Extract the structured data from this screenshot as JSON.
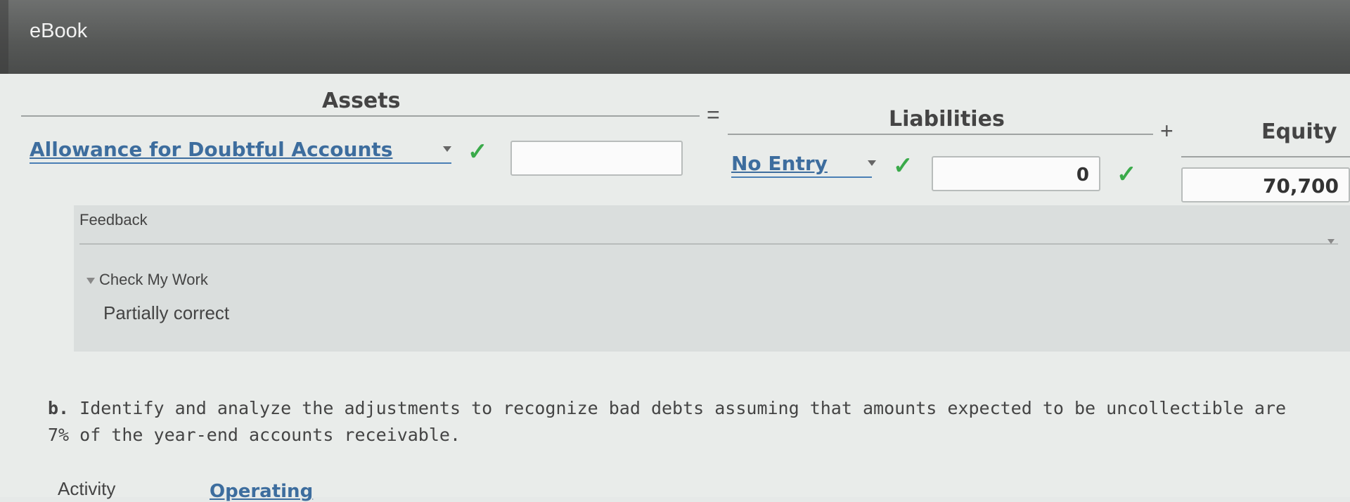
{
  "app": {
    "title": "eBook"
  },
  "equation": {
    "assets_label": "Assets",
    "equals_symbol": "=",
    "liabilities_label": "Liabilities",
    "plus_symbol": "+",
    "equity_label": "Equity"
  },
  "row": {
    "assets_account": "Allowance for Doubtful Accounts",
    "assets_amount": "",
    "liabilities_account": "No Entry",
    "liabilities_amount": "0",
    "equity_amount": "70,700",
    "check_mark": "✓"
  },
  "feedback": {
    "title": "Feedback",
    "check_my_work": "Check My Work",
    "result": "Partially correct"
  },
  "question": {
    "letter": "b.",
    "text": "Identify and analyze the adjustments to recognize bad debts assuming that amounts expected to be uncollectible are 7% of the year-end accounts receivable."
  },
  "activity": {
    "label": "Activity",
    "value": "Operating"
  },
  "colors": {
    "check_green": "#3aaa4a",
    "dropdown_blue": "#3d6d9e",
    "topbar_gray": "#555756"
  }
}
